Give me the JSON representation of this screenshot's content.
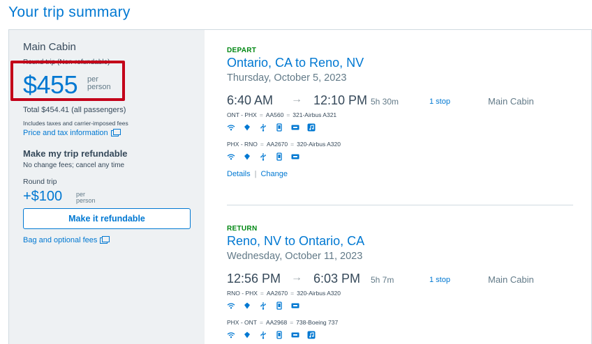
{
  "page_title": "Your trip summary",
  "summary": {
    "cabin": "Main Cabin",
    "fare_type": "Round trip (Non-refundable)",
    "price": "$455",
    "per_person": [
      "per",
      "person"
    ],
    "total": "Total $454.41 (all passengers)",
    "taxes_note": "Includes taxes and carrier-imposed fees",
    "price_tax_link": "Price and tax information",
    "refund_title": "Make my trip refundable",
    "refund_sub": "No change fees; cancel any time",
    "round_trip_label": "Round trip",
    "refund_price": "+$100",
    "refund_per": [
      "per",
      "person"
    ],
    "refund_button": "Make it refundable",
    "bag_link": "Bag and optional fees"
  },
  "depart": {
    "label": "DEPART",
    "route": "Ontario, CA to Reno, NV",
    "date": "Thursday, October 5, 2023",
    "dep_time": "6:40 AM",
    "arrow": "→",
    "arr_time": "12:10 PM",
    "duration": "5h 30m",
    "stops": "1 stop",
    "cabin": "Main Cabin",
    "leg1": {
      "route": "ONT - PHX",
      "flight": "AA560",
      "aircraft": "321-Airbus A321"
    },
    "leg2": {
      "route": "PHX - RNO",
      "flight": "AA2670",
      "aircraft": "320-Airbus A320"
    },
    "details_link": "Details",
    "change_link": "Change"
  },
  "return": {
    "label": "RETURN",
    "route": "Reno, NV to Ontario, CA",
    "date": "Wednesday, October 11, 2023",
    "dep_time": "12:56 PM",
    "arrow": "→",
    "arr_time": "6:03 PM",
    "duration": "5h 7m",
    "stops": "1 stop",
    "cabin": "Main Cabin",
    "leg1": {
      "route": "RNO - PHX",
      "flight": "AA2670",
      "aircraft": "320-Airbus A320"
    },
    "leg2": {
      "route": "PHX - ONT",
      "flight": "AA2968",
      "aircraft": "738-Boeing 737"
    }
  },
  "amenity_icons": [
    "wifi-icon",
    "power-icon",
    "usb-icon",
    "device-entertainment-icon",
    "tv-icon",
    "music-icon"
  ],
  "colors": {
    "accent": "#0078d2",
    "depart_label": "#008712",
    "highlight": "#c30019"
  }
}
